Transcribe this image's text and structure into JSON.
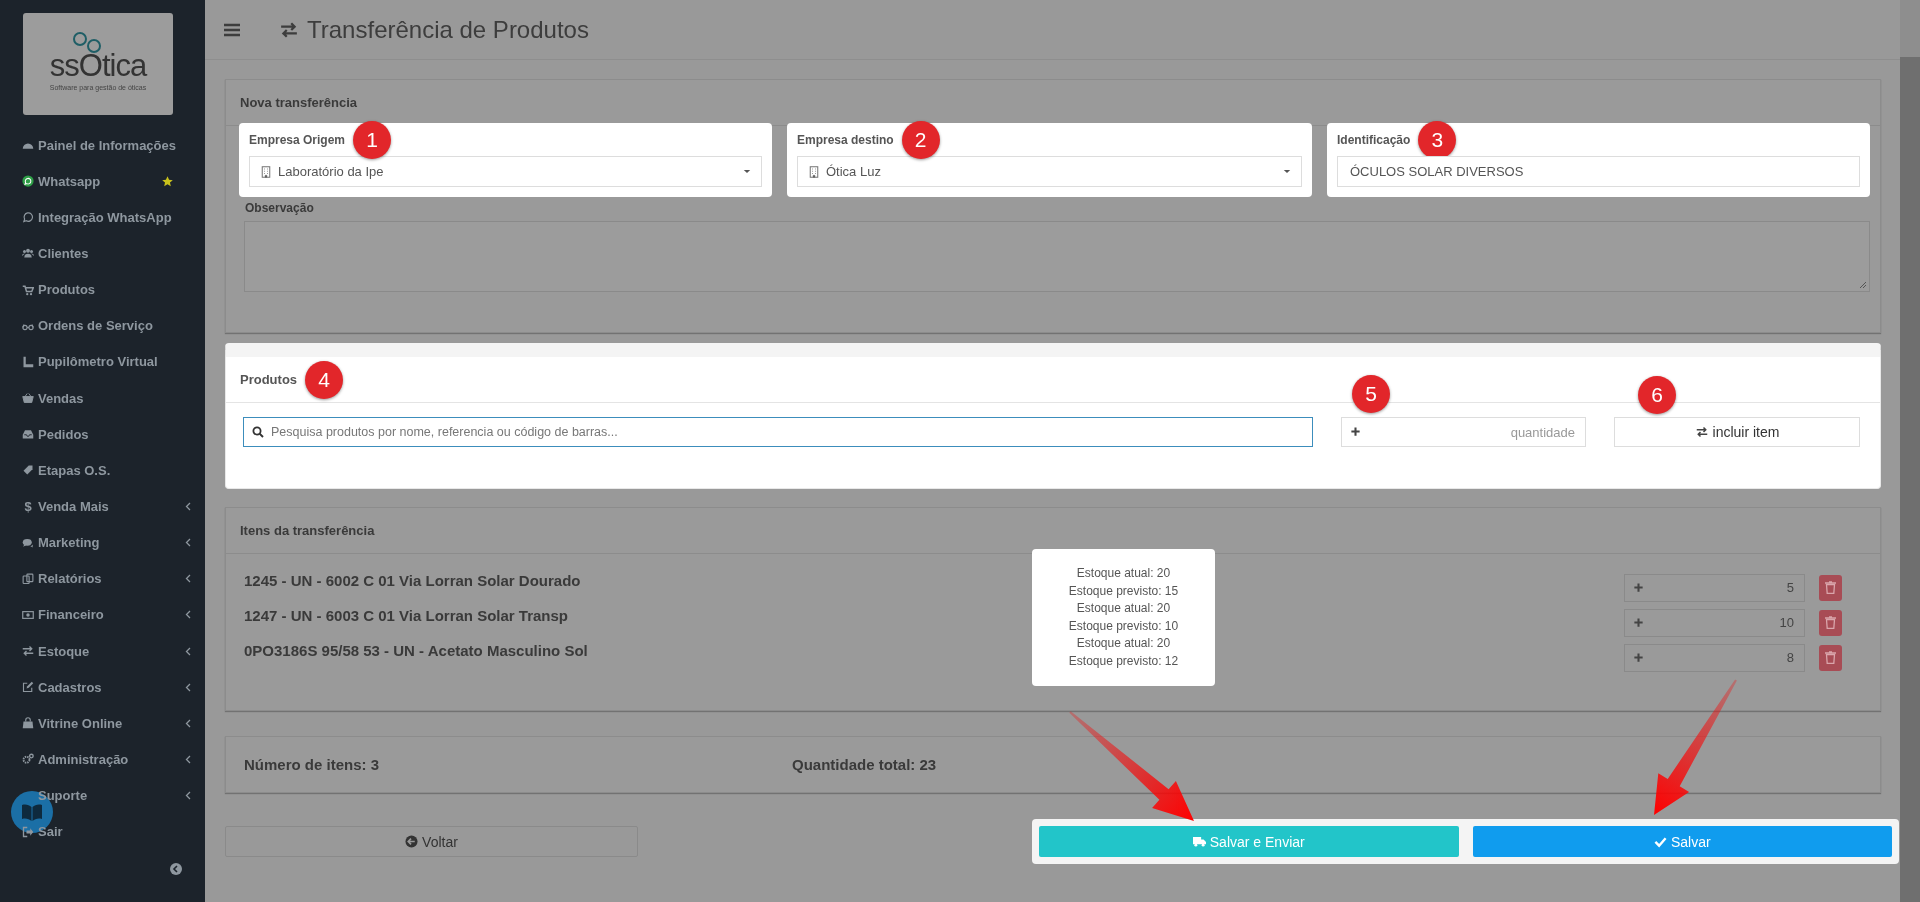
{
  "sidebar": {
    "logo": {
      "name": "ssOtica",
      "tagline": "Software para gestão de óticas"
    },
    "items": [
      {
        "label": "Painel de Informações",
        "submenu": false,
        "starred": false
      },
      {
        "label": "Whatsapp",
        "submenu": false,
        "starred": true
      },
      {
        "label": "Integração WhatsApp",
        "submenu": false,
        "starred": false
      },
      {
        "label": "Clientes",
        "submenu": false,
        "starred": false
      },
      {
        "label": "Produtos",
        "submenu": false,
        "starred": false
      },
      {
        "label": "Ordens de Serviço",
        "submenu": false,
        "starred": false
      },
      {
        "label": "Pupilômetro Virtual",
        "submenu": false,
        "starred": false
      },
      {
        "label": "Vendas",
        "submenu": false,
        "starred": false
      },
      {
        "label": "Pedidos",
        "submenu": false,
        "starred": false
      },
      {
        "label": "Etapas O.S.",
        "submenu": false,
        "starred": false
      },
      {
        "label": "Venda Mais",
        "glyph": "$",
        "submenu": true,
        "starred": false
      },
      {
        "label": "Marketing",
        "submenu": true,
        "starred": false
      },
      {
        "label": "Relatórios",
        "submenu": true,
        "starred": false
      },
      {
        "label": "Financeiro",
        "submenu": true,
        "starred": false
      },
      {
        "label": "Estoque",
        "submenu": true,
        "starred": false
      },
      {
        "label": "Cadastros",
        "submenu": true,
        "starred": false
      },
      {
        "label": "Vitrine Online",
        "submenu": true,
        "starred": false
      },
      {
        "label": "Administração",
        "submenu": true,
        "starred": false
      },
      {
        "label": "Suporte",
        "submenu": true,
        "starred": false
      },
      {
        "label": "Sair",
        "submenu": false,
        "starred": false
      }
    ]
  },
  "header": {
    "title": "Transferência de Produtos"
  },
  "new_transfer": {
    "title": "Nova transferência",
    "origin": {
      "label": "Empresa Origem",
      "value": "Laboratório da Ipe",
      "step": "1"
    },
    "destination": {
      "label": "Empresa destino",
      "value": "Ótica Luz",
      "step": "2"
    },
    "identification": {
      "label": "Identificação",
      "value": "ÓCULOS SOLAR DIVERSOS",
      "step": "3"
    },
    "notes": {
      "label": "Observação"
    }
  },
  "products": {
    "title": "Produtos",
    "step": "4",
    "search": {
      "placeholder": "Pesquisa produtos por nome, referencia ou código de barras...",
      "focused": true
    },
    "quantity": {
      "placeholder": "quantidade",
      "step": "5"
    },
    "add_button": {
      "label": "incluir item",
      "step": "6"
    }
  },
  "transfer_items": {
    "title": "Itens da transferência",
    "rows": [
      {
        "description": "1245 - UN - 6002 C 01 Via Lorran Solar Dourado",
        "quantity": "5"
      },
      {
        "description": "1247 - UN - 6003 C 01 Via Lorran Solar Transp",
        "quantity": "10"
      },
      {
        "description": "0PO3186S 95/58 53 - UN - Acetato Masculino Sol",
        "quantity": "8"
      }
    ],
    "tooltip": [
      "Estoque atual: 20",
      "Estoque previsto: 15",
      "Estoque atual: 20",
      "Estoque previsto: 10",
      "Estoque atual: 20",
      "Estoque previsto: 12"
    ]
  },
  "summary": {
    "item_count": "Número de itens: 3",
    "total_quantity": "Quantidade total: 23"
  },
  "actions": {
    "back": "Voltar",
    "save_send": "Salvar e Enviar",
    "save": "Salvar"
  }
}
